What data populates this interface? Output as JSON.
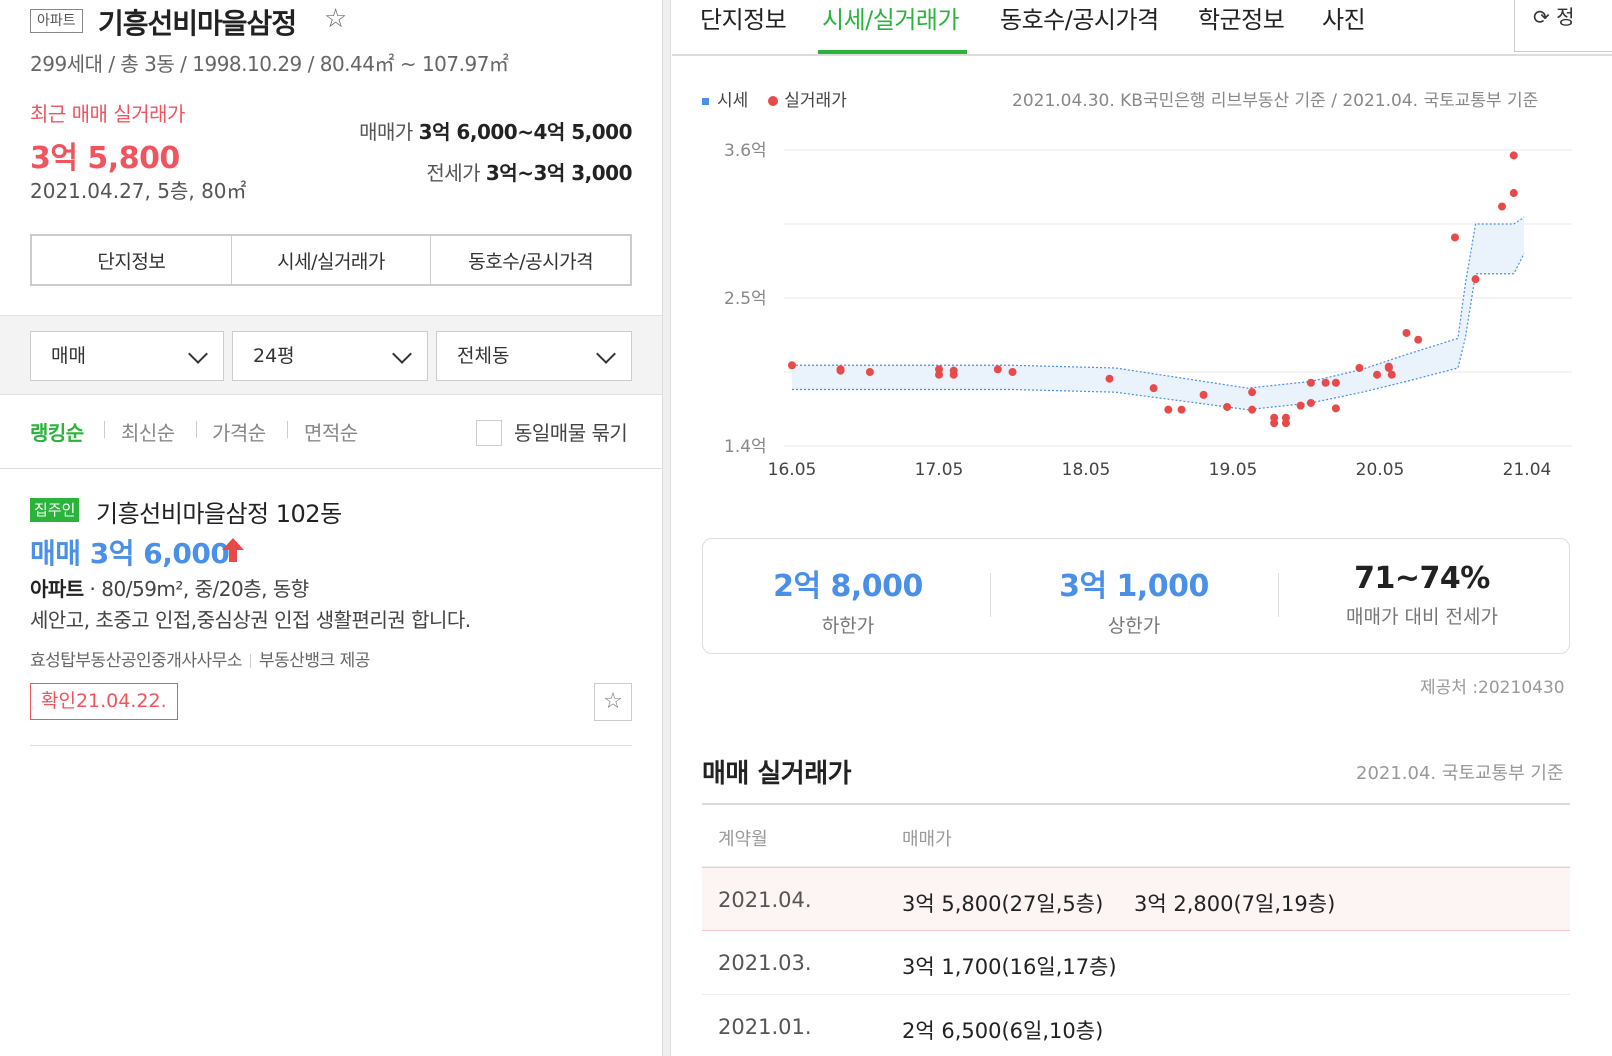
{
  "complex": {
    "type_badge": "아파트",
    "name": "기흥선비마을삼정",
    "meta": "299세대 / 총 3동 / 1998.10.29 / 80.44㎡ ~ 107.97㎡"
  },
  "recent": {
    "label": "최근 매매 실거래가",
    "price": "3억 5,800",
    "info": "2021.04.27, 5층, 80㎡",
    "sale_label": "매매가",
    "sale_value": "3억 6,000~4억 5,000",
    "jeonse_label": "전세가",
    "jeonse_value": "3억~3억 3,000"
  },
  "left_tabs": [
    "단지정보",
    "시세/실거래가",
    "동호수/공시가격"
  ],
  "filters": [
    "매매",
    "24평",
    "전체동"
  ],
  "sort": {
    "items": [
      "랭킹순",
      "최신순",
      "가격순",
      "면적순"
    ],
    "dup_label": "동일매물 묶기"
  },
  "article": {
    "owner_badge": "집주인",
    "name": "기흥선비마을삼정 102동",
    "price": "매매 3억 6,000",
    "spec_type": "아파트",
    "spec_detail": " · 80/59m², 중/20층, 동향",
    "desc": "세안고, 초중고 인접,중심상권 인접 생활편리권 합니다.",
    "agent": "효성탑부동산공인중개사사무소",
    "provider": "부동산뱅크 제공",
    "confirm": "확인21.04.22."
  },
  "right_tabs": [
    "단지정보",
    "시세/실거래가",
    "동호수/공시가격",
    "학군정보",
    "사진"
  ],
  "refresh_label": "⟳ 정",
  "legend": {
    "market": "시세",
    "actual": "실거래가"
  },
  "source_note": "2021.04.30. KB국민은행 리브부동산 기준 / 2021.04. 국토교통부 기준",
  "stats": [
    {
      "value": "2억 8,000",
      "label": "하한가"
    },
    {
      "value": "3억 1,000",
      "label": "상한가"
    },
    {
      "value": "71~74%",
      "label": "매매가 대비 전세가"
    }
  ],
  "provider_note": "제공처 :20210430",
  "trades": {
    "title": "매매 실거래가",
    "source": "2021.04. 국토교통부 기준",
    "head_month": "계약월",
    "head_price": "매매가",
    "rows": [
      {
        "month": "2021.04.",
        "p1": "3억 5,800(27일,5층)",
        "p2": "3억 2,800(7일,19층)"
      },
      {
        "month": "2021.03.",
        "p1": "3억 1,700(16일,17층)",
        "p2": ""
      },
      {
        "month": "2021.01.",
        "p1": "2억 6,500(6일,10층)",
        "p2": ""
      }
    ]
  },
  "colors": {
    "accent_green": "#2ab43c",
    "price_red": "#f0555f",
    "price_blue": "#4a8fe8",
    "dot_red": "#e84a4a"
  },
  "chart_data": {
    "type": "scatter",
    "title": "",
    "xlabel": "",
    "ylabel": "",
    "x_ticks": [
      "16.05",
      "17.05",
      "18.05",
      "19.05",
      "20.05",
      "21.04"
    ],
    "y_ticks": [
      "1.4억",
      "2.5억",
      "3.6억"
    ],
    "ylim": [
      1.4,
      3.6
    ],
    "unit": "억",
    "series": [
      {
        "name": "실거래가",
        "points": [
          [
            2016.42,
            2.0
          ],
          [
            2016.75,
            1.97
          ],
          [
            2016.75,
            1.96
          ],
          [
            2016.95,
            1.95
          ],
          [
            2017.42,
            1.97
          ],
          [
            2017.42,
            1.93
          ],
          [
            2017.52,
            1.96
          ],
          [
            2017.52,
            1.93
          ],
          [
            2017.82,
            1.97
          ],
          [
            2017.92,
            1.95
          ],
          [
            2018.58,
            1.9
          ],
          [
            2018.88,
            1.83
          ],
          [
            2018.98,
            1.67
          ],
          [
            2019.07,
            1.67
          ],
          [
            2019.22,
            1.78
          ],
          [
            2019.38,
            1.69
          ],
          [
            2019.55,
            1.67
          ],
          [
            2019.55,
            1.8
          ],
          [
            2019.7,
            1.61
          ],
          [
            2019.7,
            1.57
          ],
          [
            2019.78,
            1.61
          ],
          [
            2019.78,
            1.57
          ],
          [
            2019.88,
            1.7
          ],
          [
            2019.95,
            1.87
          ],
          [
            2019.95,
            1.72
          ],
          [
            2020.05,
            1.87
          ],
          [
            2020.12,
            1.87
          ],
          [
            2020.12,
            1.68
          ],
          [
            2020.28,
            1.98
          ],
          [
            2020.4,
            1.93
          ],
          [
            2020.48,
            1.98
          ],
          [
            2020.48,
            1.99
          ],
          [
            2020.5,
            1.93
          ],
          [
            2020.6,
            2.24
          ],
          [
            2020.68,
            2.19
          ],
          [
            2020.93,
            2.95
          ],
          [
            2021.07,
            2.64
          ],
          [
            2021.25,
            3.18
          ],
          [
            2021.33,
            3.28
          ],
          [
            2021.33,
            3.56
          ]
        ]
      },
      {
        "name": "시세",
        "upper": [
          [
            2016.42,
            2.0
          ],
          [
            2017.92,
            2.0
          ],
          [
            2018.62,
            1.98
          ],
          [
            2019.52,
            1.83
          ],
          [
            2019.95,
            1.88
          ],
          [
            2020.3,
            1.97
          ],
          [
            2020.6,
            2.08
          ],
          [
            2020.95,
            2.2
          ],
          [
            2021.0,
            2.6
          ],
          [
            2021.07,
            3.05
          ],
          [
            2021.33,
            3.05
          ],
          [
            2021.4,
            3.1
          ]
        ],
        "lower": [
          [
            2016.42,
            1.82
          ],
          [
            2017.92,
            1.82
          ],
          [
            2018.62,
            1.8
          ],
          [
            2019.52,
            1.67
          ],
          [
            2019.95,
            1.72
          ],
          [
            2020.3,
            1.8
          ],
          [
            2020.6,
            1.88
          ],
          [
            2020.95,
            1.98
          ],
          [
            2021.0,
            2.2
          ],
          [
            2021.07,
            2.68
          ],
          [
            2021.33,
            2.68
          ],
          [
            2021.4,
            2.83
          ]
        ]
      }
    ],
    "grid": true,
    "legend_position": "top-left"
  }
}
